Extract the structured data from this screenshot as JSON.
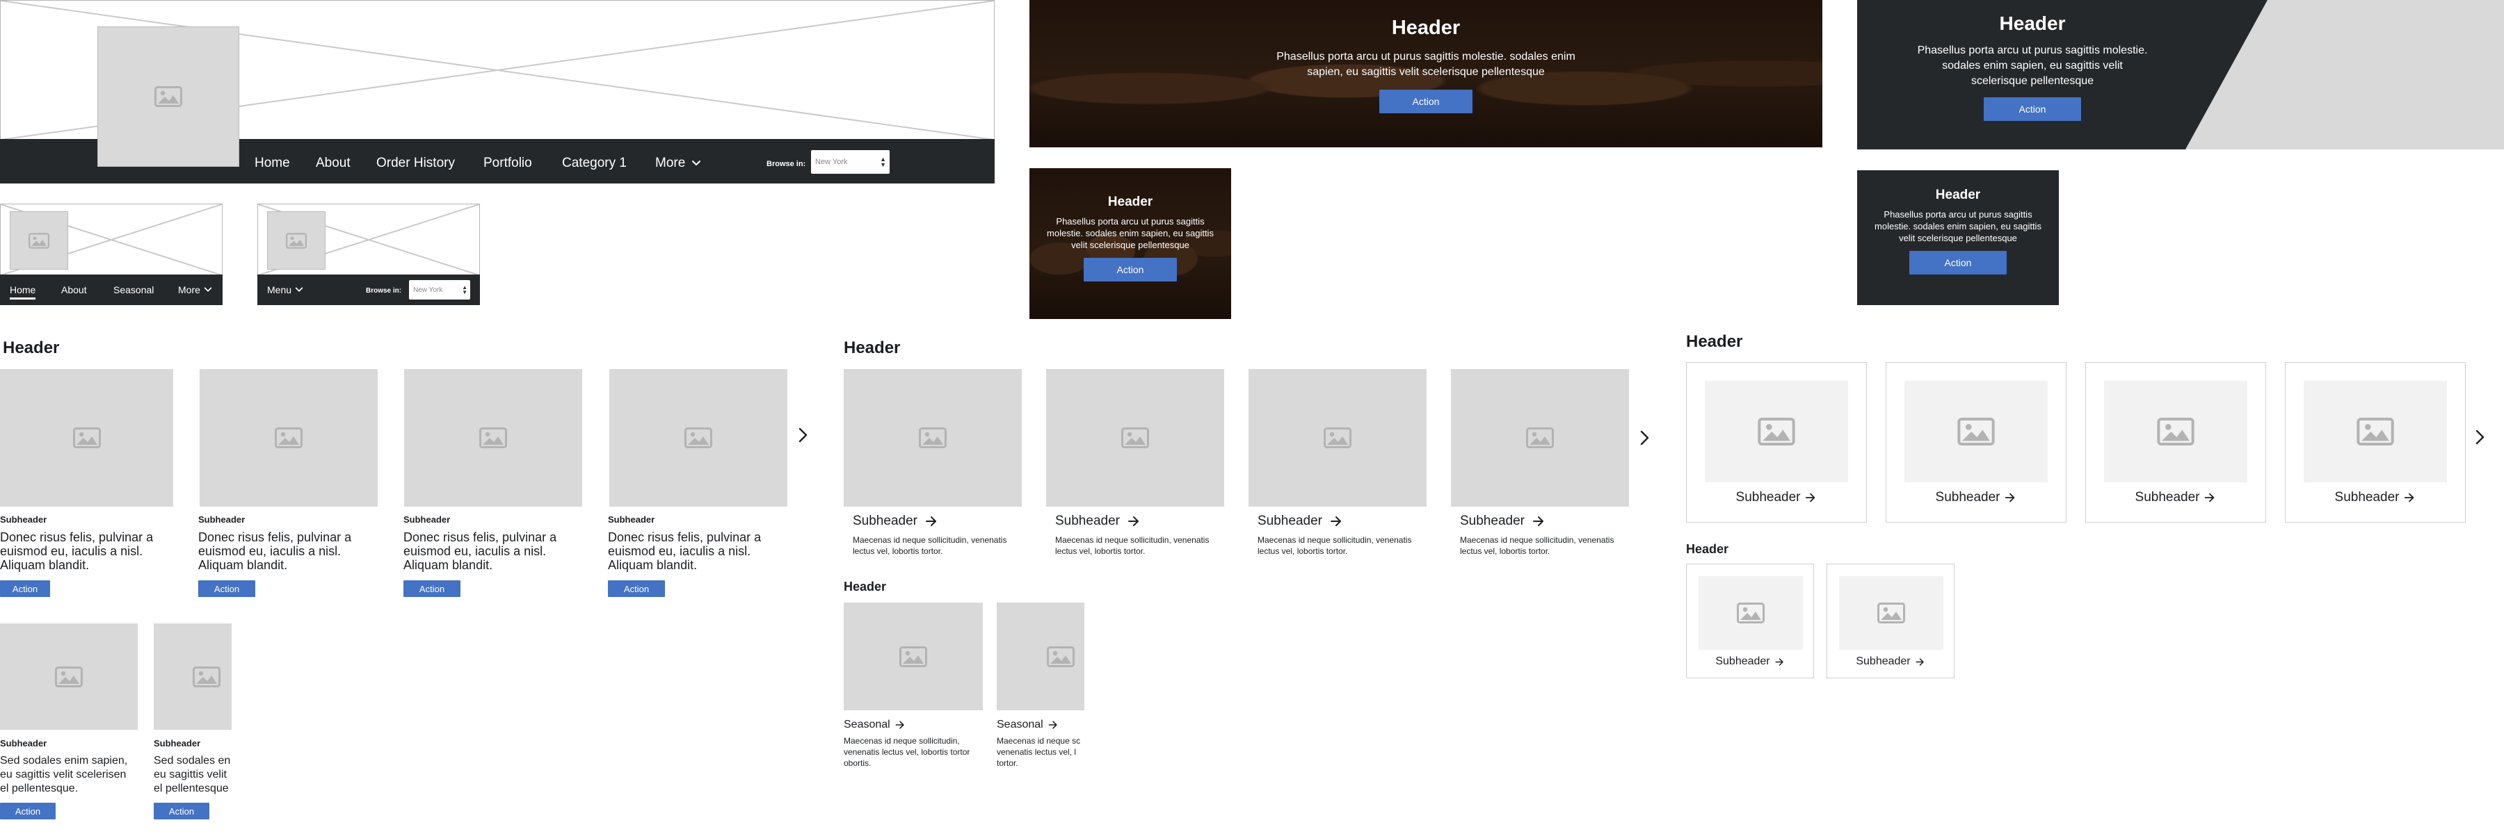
{
  "nav_desktop": {
    "items": [
      "Home",
      "About",
      "Order History",
      "Portfolio",
      "Category 1"
    ],
    "more": "More",
    "browse_label": "Browse in:",
    "browse_value": "New York"
  },
  "nav_mobile_a": {
    "items": [
      "Home",
      "About",
      "Seasonal"
    ],
    "more": "More"
  },
  "nav_mobile_b": {
    "menu": "Menu",
    "browse_label": "Browse in:",
    "browse_value": "New York"
  },
  "hero_large": {
    "header": "Header",
    "text": "Phasellus porta arcu ut purus sagittis molestie. sodales enim sapien, eu sagittis velit scelerisque pellentesque",
    "action": "Action"
  },
  "hero_small": {
    "header": "Header",
    "text": "Phasellus porta arcu ut purus sagittis molestie. sodales enim sapien, eu sagittis velit scelerisque pellentesque",
    "action": "Action"
  },
  "promo_large": {
    "header": "Header",
    "text": "Phasellus porta arcu ut purus sagittis molestie. sodales enim sapien, eu sagittis velit scelerisque pellentesque",
    "action": "Action"
  },
  "promo_small": {
    "header": "Header",
    "text": "Phasellus porta arcu ut purus sagittis molestie. sodales enim sapien, eu sagittis velit scelerisque pellentesque",
    "action": "Action"
  },
  "section_a": {
    "header": "Header",
    "cards": [
      {
        "subheader": "Subheader",
        "text": "Donec risus felis, pulvinar a euismod eu, iaculis a nisl. Aliquam blandit.",
        "action": "Action"
      },
      {
        "subheader": "Subheader",
        "text": "Donec risus felis, pulvinar a euismod eu, iaculis a nisl. Aliquam blandit.",
        "action": "Action"
      },
      {
        "subheader": "Subheader",
        "text": "Donec risus felis, pulvinar a euismod eu, iaculis a nisl. Aliquam blandit.",
        "action": "Action"
      },
      {
        "subheader": "Subheader",
        "text": "Donec risus felis, pulvinar a euismod eu, iaculis a nisl. Aliquam blandit.",
        "action": "Action"
      }
    ],
    "cards_small": [
      {
        "subheader": "Subheader",
        "text": "Sed sodales enim sapien, eu sagittis velit scelerisen el pellentesque.",
        "action": "Action"
      },
      {
        "subheader": "Subheader",
        "text": "Sed sodales en eu sagittis velit el pellentesque",
        "action": "Action"
      }
    ]
  },
  "section_b": {
    "header": "Header",
    "cards": [
      {
        "subheader": "Subheader",
        "text": "Maecenas id neque sollicitudin, venenatis lectus vel, lobortis tortor."
      },
      {
        "subheader": "Subheader",
        "text": "Maecenas id neque sollicitudin, venenatis lectus vel, lobortis tortor."
      },
      {
        "subheader": "Subheader",
        "text": "Maecenas id neque sollicitudin, venenatis lectus vel, lobortis tortor."
      },
      {
        "subheader": "Subheader",
        "text": "Maecenas id neque sollicitudin, venenatis lectus vel, lobortis tortor."
      }
    ],
    "header2": "Header",
    "cards_small": [
      {
        "label": "Seasonal",
        "text": "Maecenas id neque sollicitudin, venenatis lectus vel, lobortis tortor obortis."
      },
      {
        "label": "Seasonal",
        "text": "Maecenas id neque sc venenatis lectus vel, l tortor."
      }
    ]
  },
  "section_c": {
    "header": "Header",
    "cards": [
      {
        "subheader": "Subheader"
      },
      {
        "subheader": "Subheader"
      },
      {
        "subheader": "Subheader"
      },
      {
        "subheader": "Subheader"
      }
    ],
    "header2": "Header",
    "cards_small": [
      {
        "subheader": "Subheader"
      },
      {
        "subheader": "Subheader"
      }
    ]
  },
  "colors": {
    "accent": "#4472c4",
    "dark": "#25282b",
    "placeholder": "#d9d9d9"
  }
}
